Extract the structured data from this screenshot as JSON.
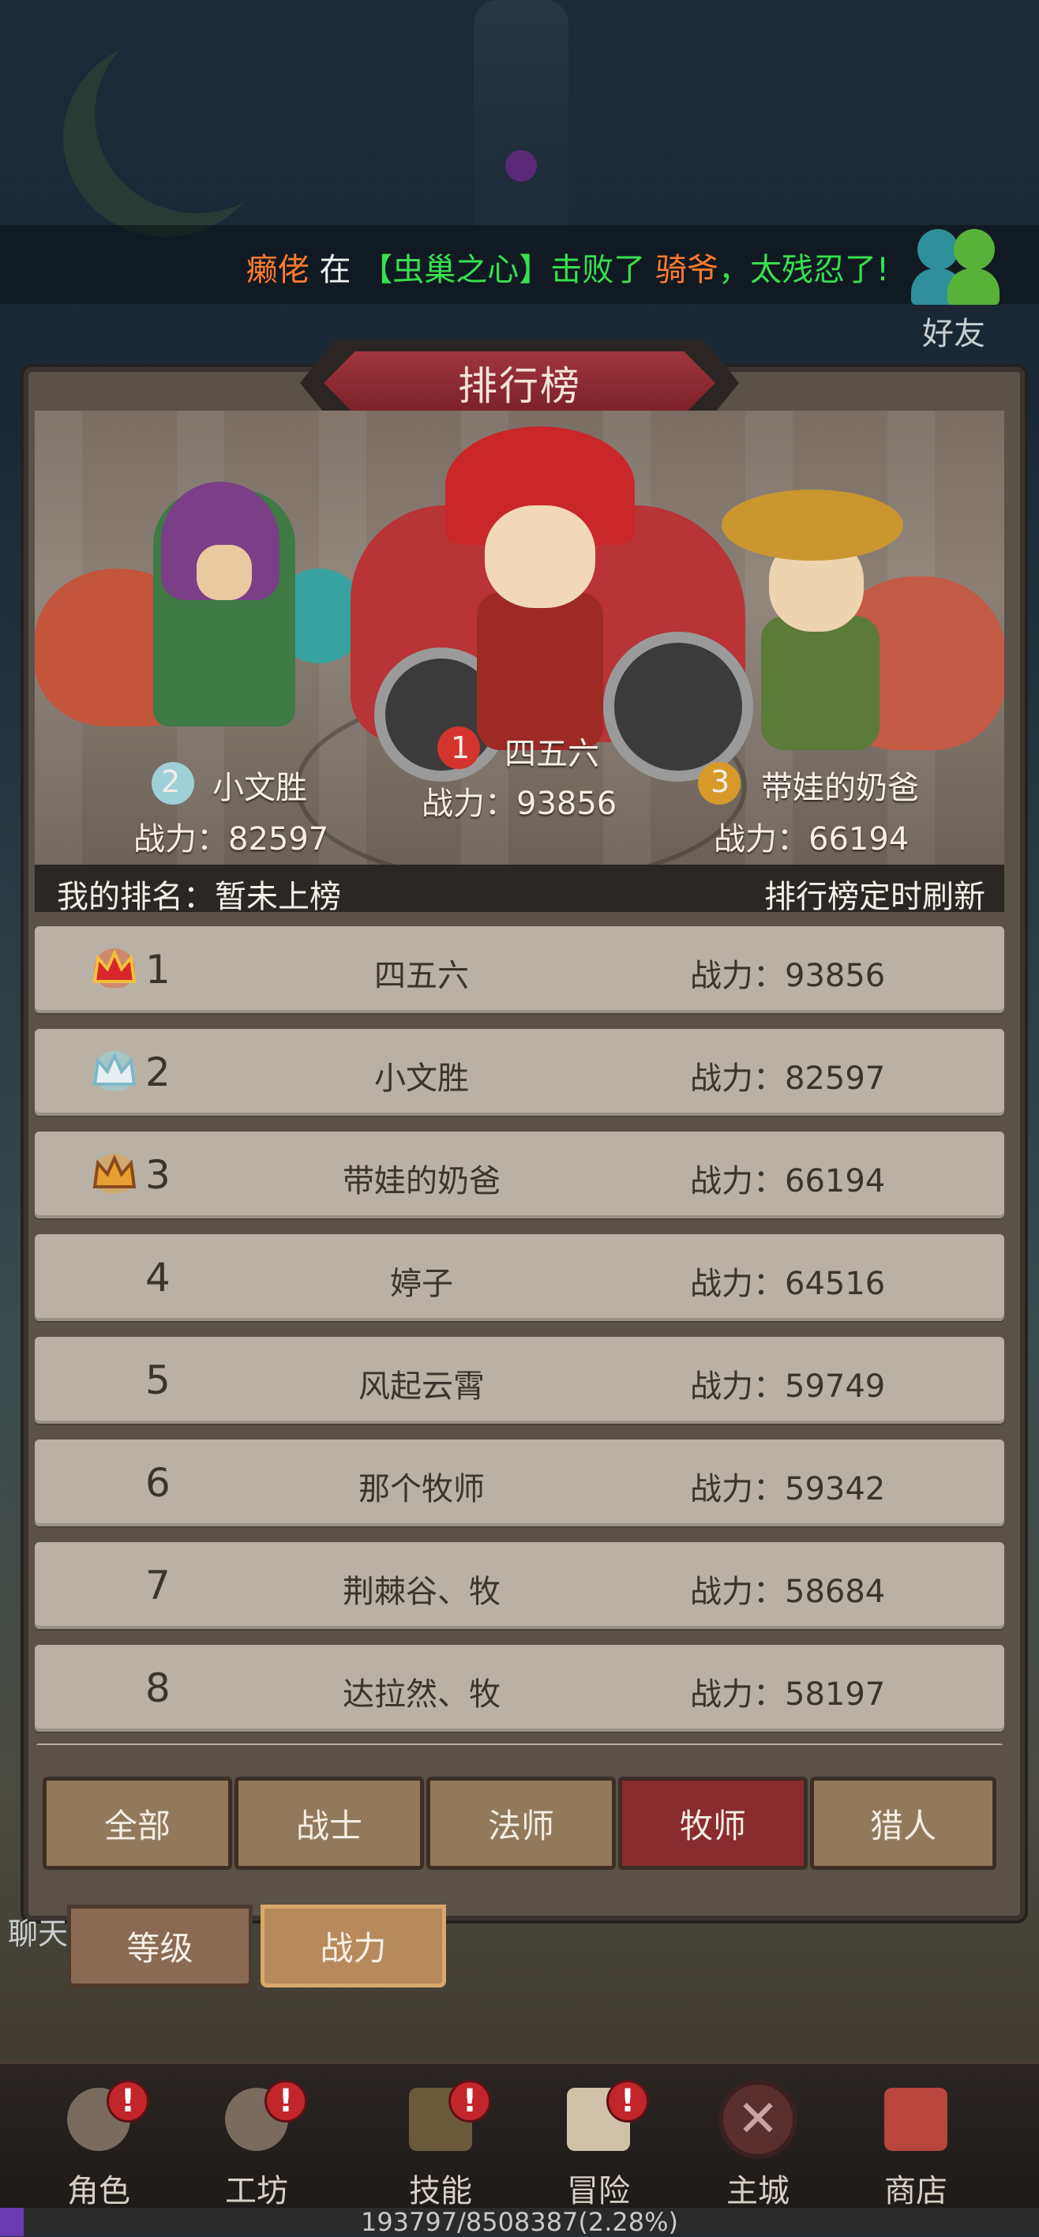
{
  "broadcast": {
    "player": "癞佬",
    "word_at": "在",
    "location": "【虫巢之心】",
    "action": "击败了",
    "victim": "骑爷",
    "suffix": "，太残忍了!"
  },
  "friend": {
    "label": "好友",
    "icon": "friends-icon"
  },
  "leaderboard": {
    "title": "排行榜",
    "podium": [
      {
        "rank": "2",
        "name": "小文胜",
        "power": "战力：82597"
      },
      {
        "rank": "1",
        "name": "四五六",
        "power": "战力：93856"
      },
      {
        "rank": "3",
        "name": "带娃的奶爸",
        "power": "战力：66194"
      }
    ],
    "my_rank": "我的排名：暂未上榜",
    "refresh_note": "排行榜定时刷新",
    "rows": [
      {
        "rank": "1",
        "name": "四五六",
        "power": "战力：93856",
        "crown": "gold-crown-icon"
      },
      {
        "rank": "2",
        "name": "小文胜",
        "power": "战力：82597",
        "crown": "silver-crown-icon"
      },
      {
        "rank": "3",
        "name": "带娃的奶爸",
        "power": "战力：66194",
        "crown": "bronze-crown-icon"
      },
      {
        "rank": "4",
        "name": "婷子",
        "power": "战力：64516"
      },
      {
        "rank": "5",
        "name": "风起云霄",
        "power": "战力：59749"
      },
      {
        "rank": "6",
        "name": "那个牧师",
        "power": "战力：59342"
      },
      {
        "rank": "7",
        "name": "荆棘谷、牧",
        "power": "战力：58684"
      },
      {
        "rank": "8",
        "name": "达拉然、牧",
        "power": "战力：58197"
      }
    ],
    "class_tabs": [
      "全部",
      "战士",
      "法师",
      "牧师",
      "猎人"
    ],
    "active_class_tab": "牧师",
    "sort_tabs": [
      "等级",
      "战力"
    ],
    "active_sort_tab": "战力"
  },
  "chat_label": "聊天",
  "bottom_nav": [
    {
      "label": "角色",
      "badge": "!"
    },
    {
      "label": "工坊",
      "badge": "!"
    },
    {
      "label": "技能",
      "badge": "!"
    },
    {
      "label": "冒险",
      "badge": "!"
    },
    {
      "label": "主城",
      "badge": ""
    },
    {
      "label": "商店",
      "badge": ""
    }
  ],
  "exp": {
    "text": "193797/8508387(2.28%)",
    "percent": 2.28
  },
  "colors": {
    "accent_red": "#8a2b2e",
    "green_text": "#37e04e",
    "orange_text": "#ff7a2e"
  }
}
